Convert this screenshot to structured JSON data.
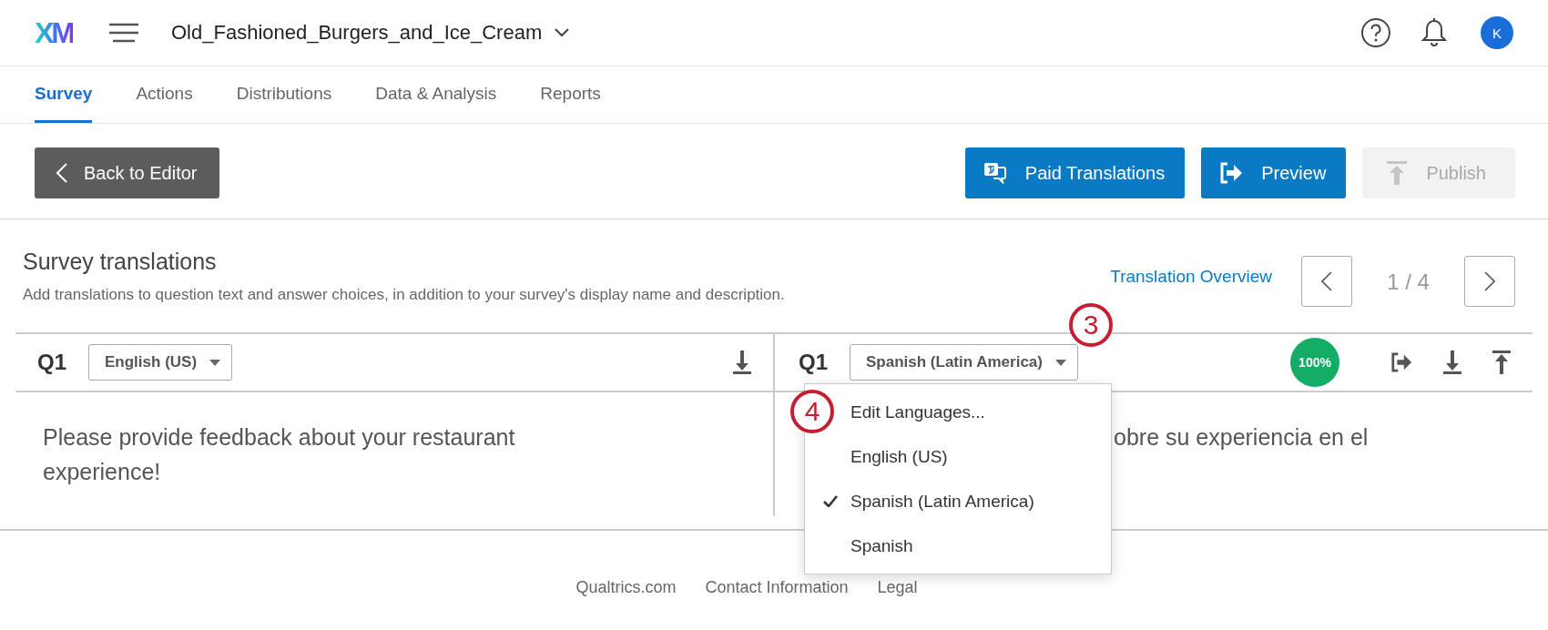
{
  "header": {
    "logo": "XM",
    "project": "Old_Fashioned_Burgers_and_Ice_Cream",
    "avatar": "K"
  },
  "tabs": [
    {
      "label": "Survey",
      "selected": true
    },
    {
      "label": "Actions",
      "selected": false
    },
    {
      "label": "Distributions",
      "selected": false
    },
    {
      "label": "Data & Analysis",
      "selected": false
    },
    {
      "label": "Reports",
      "selected": false
    }
  ],
  "toolbar": {
    "back": "Back to Editor",
    "buttons": [
      {
        "label": "Paid Translations",
        "kind": "translate",
        "disabled": false
      },
      {
        "label": "Preview",
        "kind": "preview",
        "disabled": false
      },
      {
        "label": "Publish",
        "kind": "publish",
        "disabled": true
      }
    ]
  },
  "section": {
    "title": "Survey translations",
    "subtitle": "Add translations to question text and answer choices, in addition to your survey's display name and description.",
    "overview_link": "Translation Overview",
    "pager": "1 / 4"
  },
  "panes": [
    {
      "question": "Q1",
      "language": "English (US)",
      "text": "Please provide feedback about your restaurant experience!"
    },
    {
      "question": "Q1",
      "language": "Spanish (Latin America)",
      "text": "obre su experiencia en el",
      "badge": "100%"
    }
  ],
  "language_menu": {
    "items": [
      {
        "label": "Edit Languages...",
        "checked": false
      },
      {
        "label": "English (US)",
        "checked": false
      },
      {
        "label": "Spanish (Latin America)",
        "checked": true
      },
      {
        "label": "Spanish",
        "checked": false
      }
    ]
  },
  "callouts": [
    {
      "number": "3"
    },
    {
      "number": "4"
    }
  ],
  "footer": {
    "links": [
      "Qualtrics.com",
      "Contact Information",
      "Legal"
    ]
  }
}
